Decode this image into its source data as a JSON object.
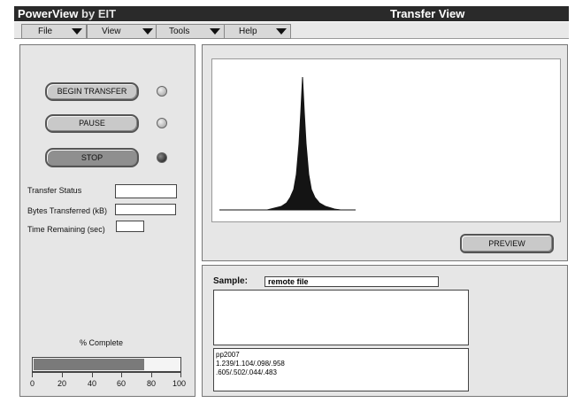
{
  "app": {
    "name": "PowerView",
    "by": "by EIT",
    "view_title": "Transfer View"
  },
  "menu": {
    "items": [
      "File",
      "View",
      "Tools",
      "Help"
    ]
  },
  "controls": {
    "begin_label": "BEGIN TRANSFER",
    "pause_label": "PAUSE",
    "stop_label": "STOP"
  },
  "status": {
    "transfer_status_label": "Transfer Status",
    "bytes_label": "Bytes Transferred (kB)",
    "time_label": "Time Remaining (sec)",
    "transfer_status_value": "",
    "bytes_value": "",
    "time_value": ""
  },
  "progress": {
    "label": "% Complete",
    "value_percent": 76,
    "ticks": [
      "0",
      "20",
      "40",
      "60",
      "80",
      "100"
    ]
  },
  "preview": {
    "button_label": "PREVIEW"
  },
  "sample": {
    "label": "Sample:",
    "value": "remote file",
    "lines": [
      "pp2007",
      "1.239/1.104/.098/.958",
      ".605/.502/.044/.483"
    ]
  },
  "colors": {
    "titlebar": "#2a2a2a",
    "panel": "#e6e6e6",
    "progress_fill": "#7a7a7a",
    "led_off": "#b5b5b5",
    "led_on": "#111111"
  }
}
